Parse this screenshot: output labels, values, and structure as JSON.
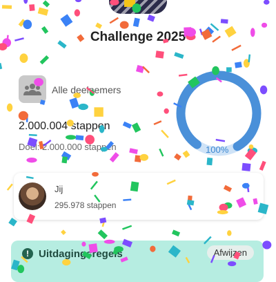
{
  "challenge": {
    "title": "Challenge 2025"
  },
  "group": {
    "label": "Alle deelnemers",
    "icon": "group-icon",
    "total_steps": "2.000.004 stappen",
    "goal": "Doel: 2.000.000 stappen",
    "progress_label": "100%",
    "progress": 1.0
  },
  "me": {
    "name": "Jij",
    "steps": "295.978 stappen"
  },
  "rules": {
    "icon": "info-icon",
    "title": "Uitdagingsregels",
    "dismiss_label": "Afwijzen"
  },
  "colors": {
    "ring": "#4a90d9",
    "ring_track": "#cfe3f7",
    "rules_banner": "#b6ede1",
    "confetti": [
      "#f26b3a",
      "#ffd23f",
      "#3b82f6",
      "#7c4dff",
      "#22c55e",
      "#ef4de8",
      "#ff4f7b",
      "#2bb6c9"
    ]
  }
}
